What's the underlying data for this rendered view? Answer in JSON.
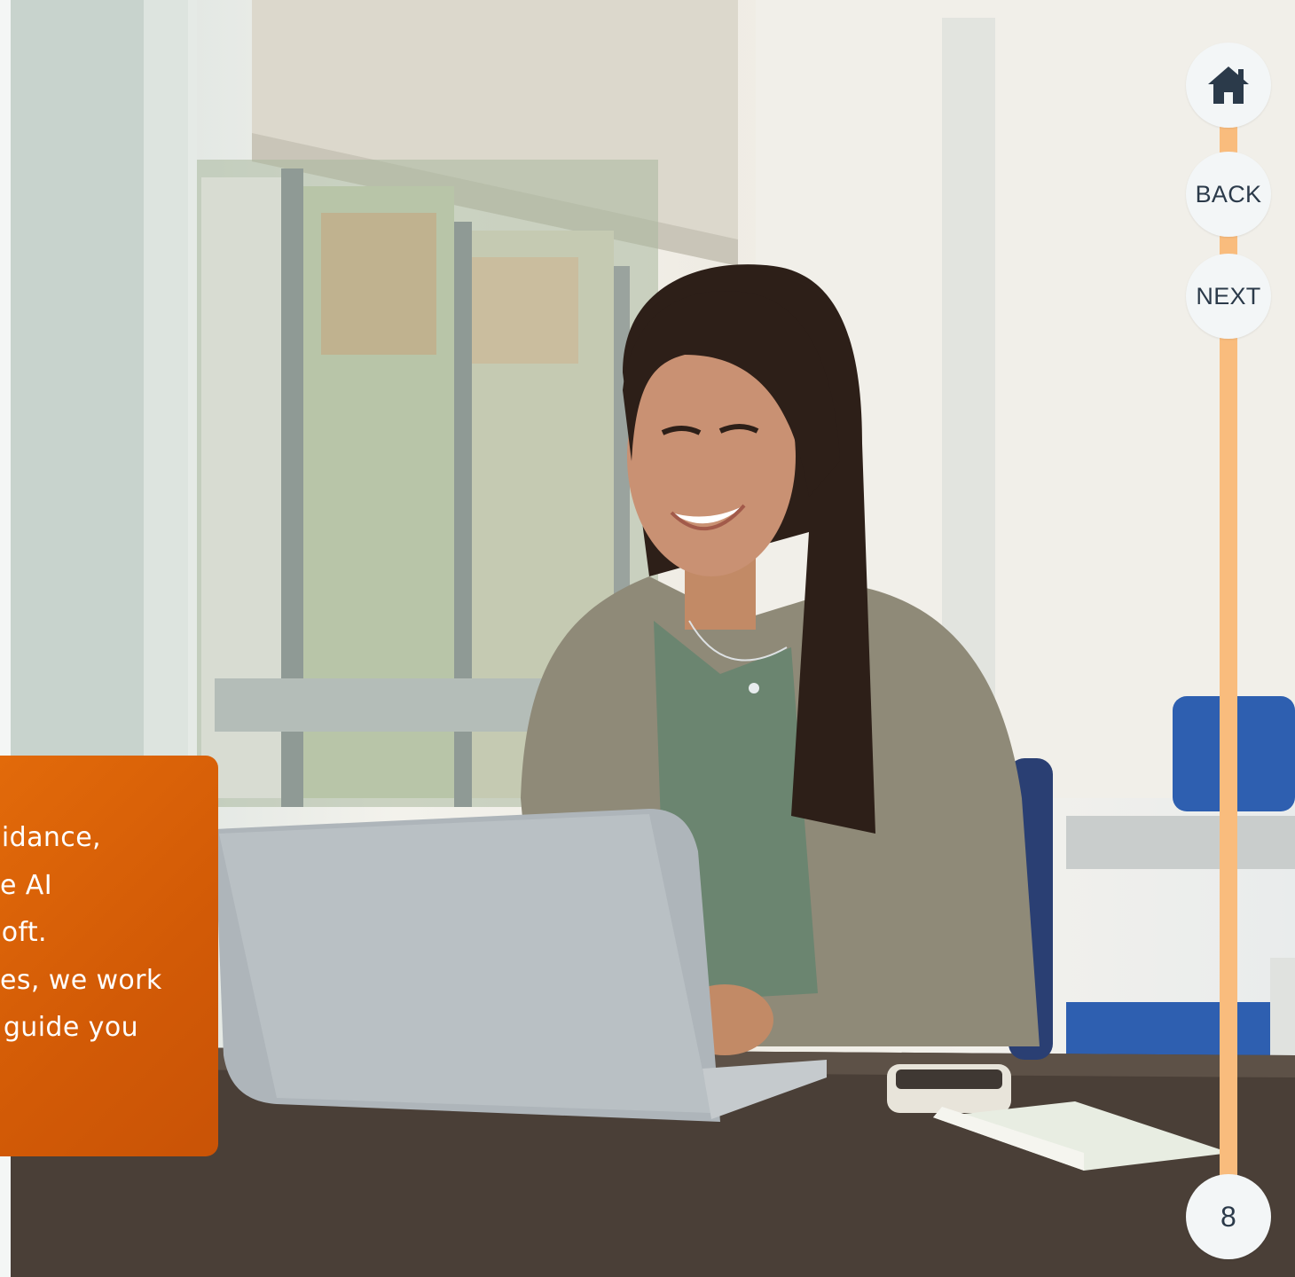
{
  "card": {
    "lines": [
      "idance,",
      "e AI",
      "oft.",
      "es, we work",
      "guide you"
    ]
  },
  "nav": {
    "home_icon": "home-icon",
    "back_label": "BACK",
    "next_label": "NEXT",
    "page_number": "8"
  },
  "colors": {
    "card": "#d85e06",
    "rail": "#f9bc7d",
    "button": "#f3f6f7",
    "button_text": "#2b3a4a"
  },
  "photo": {
    "subject": "smiling woman working on a laptop at a desk in a bright office"
  }
}
